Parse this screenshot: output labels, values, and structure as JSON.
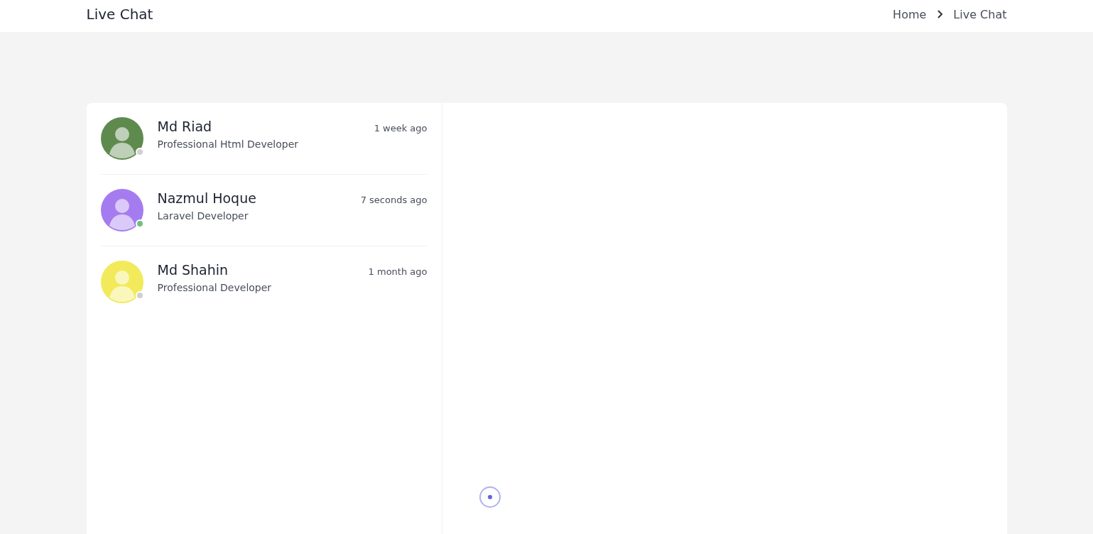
{
  "header": {
    "title": "Live Chat",
    "breadcrumb": [
      "Home",
      "Live Chat"
    ]
  },
  "contacts": [
    {
      "name": "Md Riad",
      "role": "Professional Html Developer",
      "time": "1 week ago",
      "online": false,
      "color": "#5f8a4e"
    },
    {
      "name": "Nazmul Hoque",
      "role": "Laravel Developer",
      "time": "7 seconds ago",
      "online": true,
      "color": "#a57cf0"
    },
    {
      "name": "Md Shahin",
      "role": "Professional Developer",
      "time": "1 month ago",
      "online": false,
      "color": "#f2ea5a"
    }
  ],
  "chat": {
    "loading": true
  }
}
